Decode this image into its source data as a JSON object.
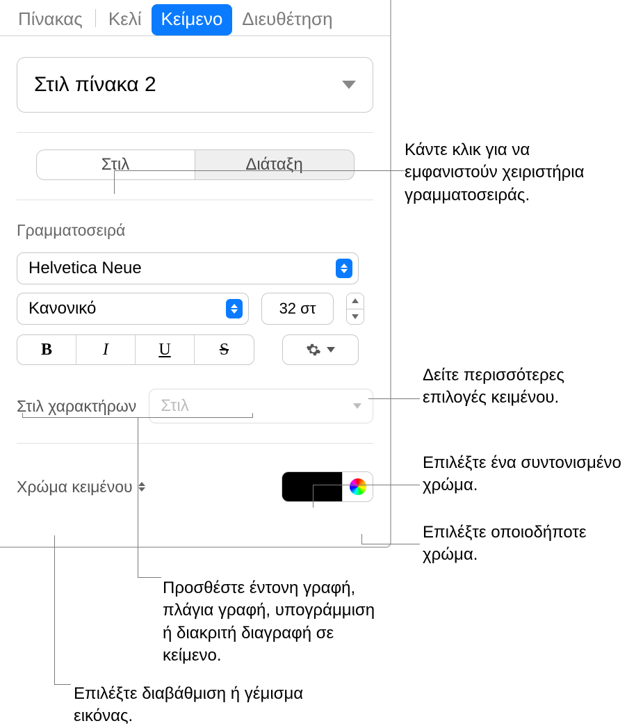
{
  "tabs": {
    "table": "Πίνακας",
    "cell": "Κελί",
    "text": "Κείμενο",
    "arrange": "Διευθέτηση"
  },
  "style_select": "Στιλ πίνακα 2",
  "segmented": {
    "style": "Στιλ",
    "layout": "Διάταξη"
  },
  "font_section": "Γραμματοσειρά",
  "font_family": "Helvetica Neue",
  "font_weight": "Κανονικό",
  "font_size": "32 στ",
  "bius": {
    "b": "B",
    "i": "I",
    "u": "U",
    "s": "S"
  },
  "char_style_label": "Στιλ χαρακτήρων",
  "char_style_value": "Στιλ",
  "text_color_label": "Χρώμα κειμένου",
  "callouts": {
    "font_controls": "Κάντε κλικ για να εμφανιστούν χειριστήρια γραμματοσειράς.",
    "more_options": "Δείτε περισσότερες επιλογές κειμένου.",
    "coord_color": "Επιλέξτε ένα συντονισμένο χρώμα.",
    "any_color": "Επιλέξτε οποιοδήποτε χρώμα.",
    "bius": "Προσθέστε έντονη γραφή, πλάγια γραφή, υπογράμμιση ή διακριτή διαγραφή σε κείμενο.",
    "gradient": "Επιλέξτε διαβάθμιση ή γέμισμα εικόνας."
  }
}
